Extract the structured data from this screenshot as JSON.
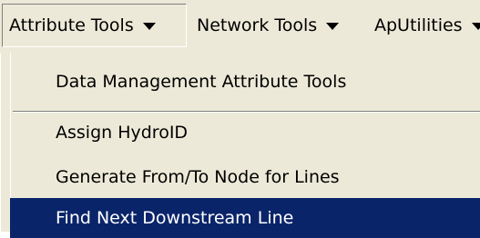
{
  "menubar": {
    "items": [
      {
        "label": "Attribute Tools",
        "state": "open"
      },
      {
        "label": "Network Tools"
      },
      {
        "label": "ApUtilities"
      }
    ]
  },
  "dropdown": {
    "items": [
      {
        "label": "Data Management Attribute Tools"
      },
      {
        "label": "Assign HydroID"
      },
      {
        "label": "Generate From/To Node for Lines"
      },
      {
        "label": "Find Next Downstream Line",
        "state": "highlighted"
      }
    ]
  },
  "colors": {
    "menu_background": "#ece9d8",
    "highlight_background": "#0a246a",
    "highlight_text": "#ffffff"
  }
}
